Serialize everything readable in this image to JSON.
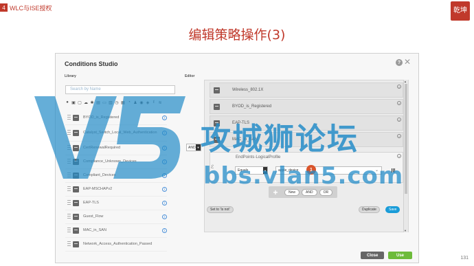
{
  "slide": {
    "tag_number": "4",
    "tag_text": "WLC与ISE授权",
    "title": "编辑策略操作(3)",
    "page_number": "131",
    "seal_text": "乾坤"
  },
  "dialog": {
    "title": "Conditions Studio",
    "help_symbol": "?",
    "close_symbol": "✕",
    "library_label": "Library",
    "search_placeholder": "Search by Name",
    "filter_icons": [
      "location-icon",
      "device-icon",
      "network-icon",
      "cloud-icon",
      "settings-icon",
      "switch-icon",
      "monitor-icon",
      "server-icon",
      "clock-icon",
      "doc-icon",
      "time-icon",
      "user-icon",
      "check-icon",
      "shield-icon",
      "link-icon",
      "wifi-icon"
    ],
    "library_items": [
      {
        "name": "BYOD_is_Registered"
      },
      {
        "name": "Catalyst_Switch_Local_Web_Authentication"
      },
      {
        "name": "CertRenewalRequired"
      },
      {
        "name": "Compliance_Unknown_Devices"
      },
      {
        "name": "Compliant_Devices"
      },
      {
        "name": "EAP-MSCHAPv2"
      },
      {
        "name": "EAP-TLS"
      },
      {
        "name": "Guest_Flow"
      },
      {
        "name": "MAC_in_SAN"
      },
      {
        "name": "Network_Access_Authentication_Passed"
      }
    ],
    "editor_label": "Editor",
    "and_operator": "AND",
    "editor_rows": [
      {
        "name": "Wireless_802.1X"
      },
      {
        "name": "BYOD_is_Registered"
      },
      {
        "name": "EAP-TLS"
      },
      {
        "name": "MAC_in_SAN"
      }
    ],
    "new_condition": {
      "attribute": "EndPoints·LogicalProfile",
      "operator": "Equals",
      "value": "apple_device",
      "badge": "1"
    },
    "toolbar": {
      "new_label": "New",
      "and_label": "AND",
      "or_label": "OR"
    },
    "set_not_label": "Set to 'Is not'",
    "duplicate_label": "Duplicate",
    "save_label": "Save",
    "close_label": "Close",
    "use_label": "Use"
  },
  "watermark": {
    "text_cn": "攻城狮论坛",
    "url": "bbs.vlan5.com"
  },
  "colors": {
    "accent_red": "#c0392b",
    "save_blue": "#1a9cd8",
    "use_green": "#6dbb3a",
    "badge_orange": "#d9542b",
    "watermark_blue": "#248cc8"
  }
}
